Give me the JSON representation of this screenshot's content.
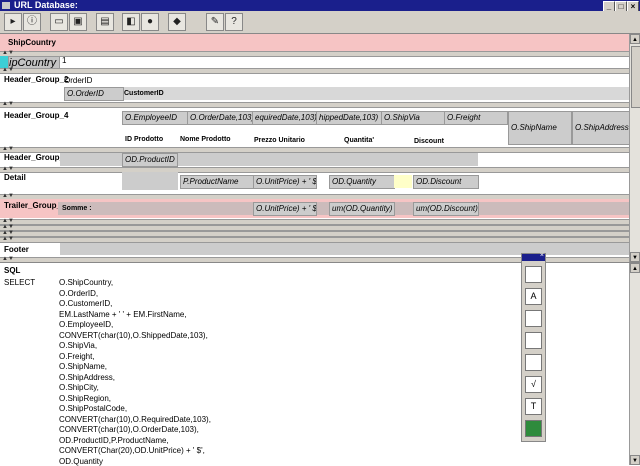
{
  "window": {
    "title": "URL Database:",
    "controls": [
      "_",
      "□",
      "×"
    ]
  },
  "toolbar": {
    "buttons": [
      "new-report-icon",
      "info-icon",
      "open-folder-icon",
      "save-icon",
      "print-icon",
      "database-icon",
      "run-icon",
      "link-icon",
      "wrench-icon",
      "help-icon"
    ]
  },
  "bands": {
    "header_ship": {
      "label": "ShipCountry",
      "field": "ipCountry",
      "extra": "1"
    },
    "header2": {
      "label": "Header_Group_2",
      "orderlbl": "OrderID",
      "field": "O.OrderID",
      "customer": "CustomerID"
    },
    "header4": {
      "label": "Header_Group_4",
      "fields": [
        "O.EmployeeID",
        "O.OrderDate,103)",
        "equiredDate,103)",
        "hippedDate,103)",
        "O.ShipVia",
        "O.Freight",
        "O.ShipName",
        "O.ShipAddress"
      ],
      "headers": [
        "ID Prodotto",
        "Nome Prodotto",
        "Prezzo Unitario",
        "Quantita'",
        "Discount"
      ]
    },
    "header5": {
      "label": "Header_Group_5",
      "field": "OD.ProductID"
    },
    "detail": {
      "label": "Detail",
      "fields": [
        "P.ProductName",
        "O.UnitPrice) + ' $'",
        "OD.Quantity",
        "OD.Discount"
      ]
    },
    "trailer": {
      "label": "Trailer_Group_",
      "somme": "Somme :",
      "fields": [
        "O.UnitPrice) + ' $'",
        "um(OD.Quantity)",
        "um(OD.Discount)"
      ]
    },
    "footer": {
      "label": "Footer"
    }
  },
  "sql": {
    "label": "SQL",
    "keyword": "SELECT",
    "lines": [
      "O.ShipCountry,",
      "O.OrderID,",
      "O.CustomerID,",
      "EM.LastName + ' ' + EM.FirstName,",
      "O.EmployeeID,",
      "CONVERT(char(10),O.ShippedDate,103),",
      "O.ShipVia,",
      "O.Freight,",
      "O.ShipName,",
      "O.ShipAddress,",
      "O.ShipCity,",
      "O.ShipRegion,",
      "O.ShipPostalCode,",
      "CONVERT(char(10),O.RequiredDate,103),",
      "CONVERT(char(10),O.OrderDate,103),",
      "OD.ProductID,P.ProductName,",
      "CONVERT(Char(20),OD.UnitPrice) + ' $',",
      "OD.Quantity"
    ]
  },
  "palette": {
    "close": "×",
    "items": [
      "rectangle-tool-icon",
      "text-tool-icon",
      "hsplit-tool-icon",
      "vsplit-tool-icon",
      "frame-tool-icon",
      "formula-tool-icon",
      "label-tool-icon",
      "image-tool-icon"
    ],
    "glyphs": [
      "",
      "A",
      "",
      "",
      "",
      "√",
      "T",
      ""
    ]
  }
}
